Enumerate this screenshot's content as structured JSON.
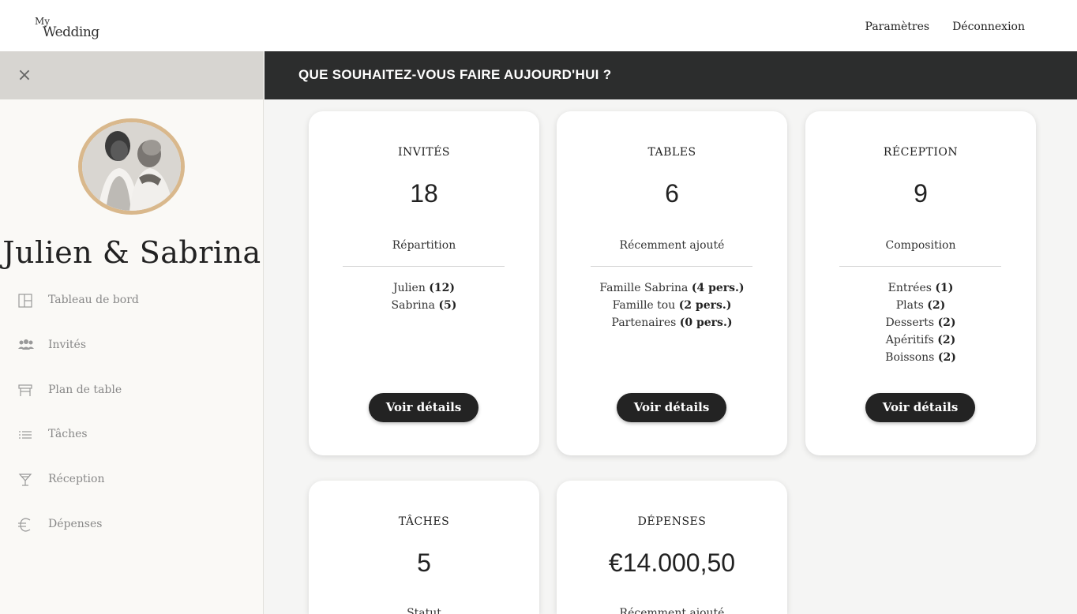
{
  "header": {
    "logo_line1": "My",
    "logo_line2": "Wedding",
    "links": [
      "Paramètres",
      "Déconnexion"
    ]
  },
  "sidebar": {
    "couple_name": "Julien & Sabrina",
    "items": [
      {
        "label": "Tableau de bord",
        "icon": "dashboard-icon"
      },
      {
        "label": "Invités",
        "icon": "guests-icon"
      },
      {
        "label": "Plan de table",
        "icon": "table-icon"
      },
      {
        "label": "Tâches",
        "icon": "list-icon"
      },
      {
        "label": "Réception",
        "icon": "cocktail-icon"
      },
      {
        "label": "Dépenses",
        "icon": "euro-icon"
      }
    ]
  },
  "banner": {
    "title": "QUE SOUHAITEZ-VOUS FAIRE AUJOURD'HUI ?"
  },
  "cards": [
    {
      "title": "INVITÉS",
      "value": "18",
      "subtitle": "Répartition",
      "rows": [
        {
          "name": "Julien ",
          "count": "(12)"
        },
        {
          "name": "Sabrina ",
          "count": "(5)"
        }
      ],
      "button": "Voir détails"
    },
    {
      "title": "TABLES",
      "value": "6",
      "subtitle": "Récemment ajouté",
      "rows": [
        {
          "name": "Famille Sabrina ",
          "count": "(4 pers.)"
        },
        {
          "name": "Famille tou ",
          "count": "(2 pers.)"
        },
        {
          "name": "Partenaires ",
          "count": "(0 pers.)"
        }
      ],
      "button": "Voir détails"
    },
    {
      "title": "RÉCEPTION",
      "value": "9",
      "subtitle": "Composition",
      "rows": [
        {
          "name": "Entrées ",
          "count": "(1)"
        },
        {
          "name": "Plats ",
          "count": "(2)"
        },
        {
          "name": "Desserts ",
          "count": "(2)"
        },
        {
          "name": "Apéritifs ",
          "count": "(2)"
        },
        {
          "name": "Boissons ",
          "count": "(2)"
        }
      ],
      "button": "Voir détails"
    },
    {
      "title": "TÂCHES",
      "value": "5",
      "subtitle": "Statut"
    },
    {
      "title": "DÉPENSES",
      "value": "€14.000,50",
      "subtitle": "Récemment ajouté"
    }
  ]
}
